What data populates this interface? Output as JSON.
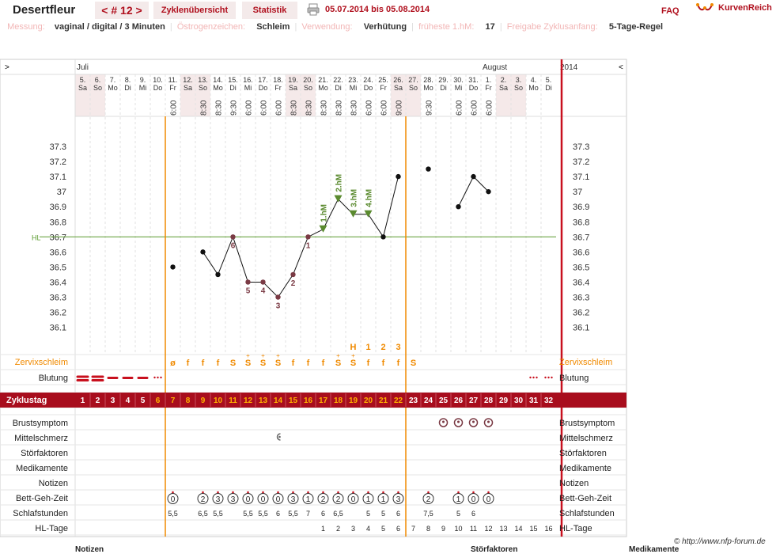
{
  "header": {
    "title": "Desertfleur",
    "cycle_label": "< # 12 >",
    "tab_overview": "Zyklenübersicht",
    "tab_stats": "Statistik",
    "date_range": "05.07.2014 bis 05.08.2014",
    "faq": "FAQ",
    "brand": "KurvenReich"
  },
  "info": {
    "measure_label": "Messung:",
    "measure_value": "vaginal / digital / 3 Minuten",
    "estrogen_label": "Östrogenzeichen:",
    "estrogen_value": "Schleim",
    "use_label": "Verwendung:",
    "use_value": "Verhütung",
    "earliest_label": "früheste 1.hM:",
    "earliest_value": "17",
    "release_label": "Freigabe Zyklusanfang:",
    "release_value": "5-Tage-Regel"
  },
  "chart_data": {
    "type": "line",
    "title": "",
    "year": "2014",
    "months": [
      {
        "label": "Juli",
        "col": 0
      },
      {
        "label": "August",
        "col": 27
      }
    ],
    "nav_left": ">",
    "nav_right": "<",
    "dates": [
      "5.",
      "6.",
      "7.",
      "8.",
      "9.",
      "10.",
      "11.",
      "12.",
      "13.",
      "14.",
      "15.",
      "16.",
      "17.",
      "18.",
      "19.",
      "20.",
      "21.",
      "22.",
      "23.",
      "24.",
      "25.",
      "26.",
      "27.",
      "28.",
      "29.",
      "30.",
      "31.",
      "1.",
      "2.",
      "3.",
      "4.",
      "5."
    ],
    "weekdays": [
      "Sa",
      "So",
      "Mo",
      "Di",
      "Mi",
      "Do",
      "Fr",
      "Sa",
      "So",
      "Mo",
      "Di",
      "Mi",
      "Do",
      "Fr",
      "Sa",
      "So",
      "Mo",
      "Di",
      "Mi",
      "Do",
      "Fr",
      "Sa",
      "So",
      "Mo",
      "Di",
      "Mi",
      "Do",
      "Fr",
      "Sa",
      "So",
      "Mo",
      "Di"
    ],
    "weekend_cols": [
      0,
      1,
      7,
      8,
      14,
      15,
      21,
      22,
      28,
      29
    ],
    "times": [
      "",
      "",
      "",
      "",
      "",
      "",
      "6:00",
      "",
      "8:30",
      "8:30",
      "9:30",
      "6:00",
      "6:00",
      "6:00",
      "8:30",
      "8:30",
      "8:30",
      "8:30",
      "8:30",
      "6:00",
      "6:00",
      "9:00",
      "",
      "9:30",
      "",
      "6:00",
      "6:00",
      "6:00",
      "",
      "",
      "",
      ""
    ],
    "ylim": [
      36.1,
      37.3
    ],
    "yticks": [
      "37.3",
      "37.2",
      "37.1",
      "37",
      "36.9",
      "36.8",
      "36.7",
      "36.6",
      "36.5",
      "36.4",
      "36.3",
      "36.2",
      "36.1"
    ],
    "coverline": 36.7,
    "coverline_label": "HL",
    "temps": [
      null,
      null,
      null,
      null,
      null,
      null,
      36.5,
      null,
      36.6,
      36.45,
      36.7,
      36.4,
      36.4,
      36.3,
      36.45,
      36.7,
      36.75,
      36.95,
      36.85,
      36.85,
      36.7,
      37.1,
      null,
      37.15,
      null,
      36.9,
      37.1,
      37.0,
      null,
      null,
      null,
      null
    ],
    "line_segments": [
      [
        8,
        21
      ],
      [
        25,
        27
      ]
    ],
    "count_labels": [
      {
        "col": 10,
        "text": "6"
      },
      {
        "col": 11,
        "text": "5"
      },
      {
        "col": 12,
        "text": "4"
      },
      {
        "col": 13,
        "text": "3"
      },
      {
        "col": 14,
        "text": "2"
      },
      {
        "col": 15,
        "text": "1"
      }
    ],
    "high_labels": [
      {
        "col": 16,
        "text": "1.hM"
      },
      {
        "col": 17,
        "text": "2.hM"
      },
      {
        "col": 18,
        "text": "3.hM"
      },
      {
        "col": 19,
        "text": "4.hM"
      }
    ],
    "mucus_peak": [
      {
        "col": 18,
        "text": "H"
      },
      {
        "col": 19,
        "text": "1"
      },
      {
        "col": 20,
        "text": "2"
      },
      {
        "col": 21,
        "text": "3"
      }
    ],
    "vlines": [
      5,
      21
    ],
    "end_col": 32
  },
  "rows": {
    "mucus_label": "Zervixschleim",
    "mucus": [
      "",
      "",
      "",
      "",
      "",
      "",
      "ø",
      "f",
      "f",
      "f",
      "S",
      "S",
      "S",
      "S",
      "f",
      "f",
      "f",
      "S",
      "S",
      "f",
      "f",
      "f",
      "S",
      "",
      "",
      "",
      "",
      "",
      "",
      "",
      "",
      ""
    ],
    "mucus_plus": [
      11,
      12,
      13,
      17,
      18
    ],
    "bleeding_label": "Blutung",
    "bleeding": [
      "heavy",
      "heavy",
      "medium",
      "medium",
      "medium",
      "spot",
      "",
      "",
      "",
      "",
      "",
      "",
      "",
      "",
      "",
      "",
      "",
      "",
      "",
      "",
      "",
      "",
      "",
      "",
      "",
      "",
      "",
      "",
      "",
      "",
      "spot",
      "spot"
    ],
    "cycleday_label": "Zyklustag",
    "cycledays": [
      "1",
      "2",
      "3",
      "4",
      "5",
      "6",
      "7",
      "8",
      "9",
      "10",
      "11",
      "12",
      "13",
      "14",
      "15",
      "16",
      "17",
      "18",
      "19",
      "20",
      "21",
      "22",
      "23",
      "24",
      "25",
      "26",
      "27",
      "28",
      "29",
      "30",
      "31",
      "32"
    ],
    "breast_label": "Brustsymptom",
    "breast": [
      24,
      25,
      26,
      27
    ],
    "pain_label": "Mittelschmerz",
    "pain": [
      13
    ],
    "disturb_label": "Störfaktoren",
    "meds_label": "Medikamente",
    "notes_label": "Notizen",
    "bed_label": "Bett-Geh-Zeit",
    "bed": [
      "",
      "",
      "",
      "",
      "",
      "",
      "0",
      "",
      "2",
      "3",
      "3",
      "0",
      "0",
      "0",
      "3",
      "1",
      "2",
      "2",
      "0",
      "1",
      "1",
      "3",
      "",
      "2",
      "",
      "1",
      "0",
      "0",
      "",
      "",
      "",
      ""
    ],
    "sleep_label": "Schlafstunden",
    "sleep": [
      "",
      "",
      "",
      "",
      "",
      "",
      "5,5",
      "",
      "6,5",
      "5,5",
      "",
      "5,5",
      "5,5",
      "6",
      "5,5",
      "7",
      "6",
      "6,5",
      "",
      "5",
      "5",
      "6",
      "",
      "7,5",
      "",
      "5",
      "6",
      "",
      "",
      "",
      "",
      ""
    ],
    "hl_label": "HL-Tage",
    "hl": [
      "",
      "",
      "",
      "",
      "",
      "",
      "",
      "",
      "",
      "",
      "",
      "",
      "",
      "",
      "",
      "",
      "1",
      "2",
      "3",
      "4",
      "5",
      "6",
      "7",
      "8",
      "9",
      "10",
      "11",
      "12",
      "13",
      "14",
      "15",
      "16"
    ]
  },
  "footer": {
    "copyright": "© http://www.nfp-forum.de",
    "notes": "Notizen",
    "disturb": "Störfaktoren",
    "meds": "Medikamente"
  },
  "colors": {
    "brand": "#b0101e",
    "orange": "#f08a00",
    "green": "#5a8a2e",
    "temp_point": "#7a3a44"
  }
}
